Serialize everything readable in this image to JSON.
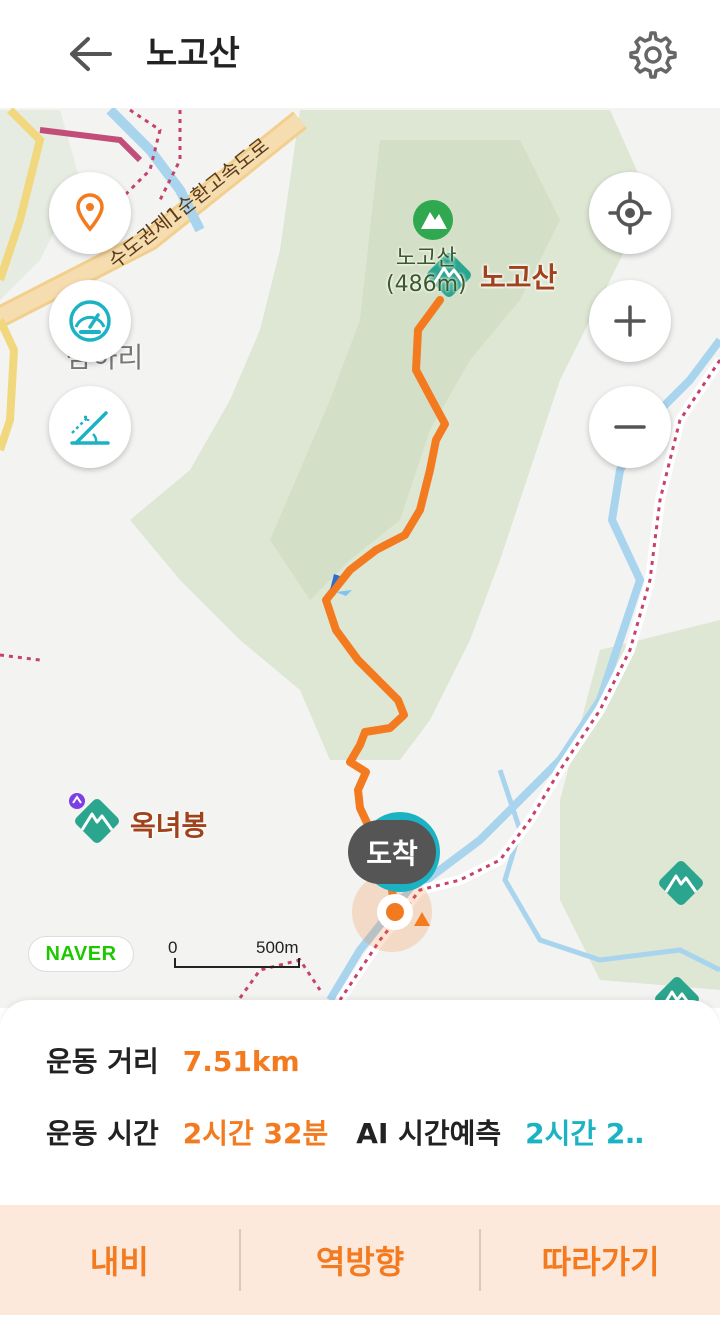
{
  "header": {
    "title": "노고산",
    "back_icon": "arrow-left-icon",
    "settings_icon": "gear-icon"
  },
  "map": {
    "labels": {
      "road": "수도권제1순환고속도로",
      "district": "삼하리",
      "peak_name_small": "노고산",
      "peak_elevation": "(486m)",
      "peak_main": "노고산",
      "peak_secondary": "옥녀봉",
      "arrive": "도착"
    },
    "left_controls": [
      {
        "name": "location-pin-icon"
      },
      {
        "name": "speedometer-icon"
      },
      {
        "name": "slope-icon"
      }
    ],
    "right_controls": [
      {
        "name": "my-location-icon"
      },
      {
        "name": "zoom-in-icon"
      },
      {
        "name": "zoom-out-icon"
      }
    ],
    "naver_logo": "NAVER",
    "scale": {
      "start": "0",
      "distance": "500m"
    },
    "colors": {
      "route": "#f47a20",
      "mountain_badge": "#2ba58d",
      "water": "#a9d4ee",
      "forest": "#dfe8d6"
    }
  },
  "stats": {
    "distance_label": "운동 거리",
    "distance_value": "7.51km",
    "time_label": "운동 시간",
    "time_value": "2시간 32분",
    "ai_label": "AI 시간예측",
    "ai_value": "2시간 2‥"
  },
  "actions": {
    "nav": "내비",
    "reverse": "역방향",
    "follow": "따라가기"
  }
}
